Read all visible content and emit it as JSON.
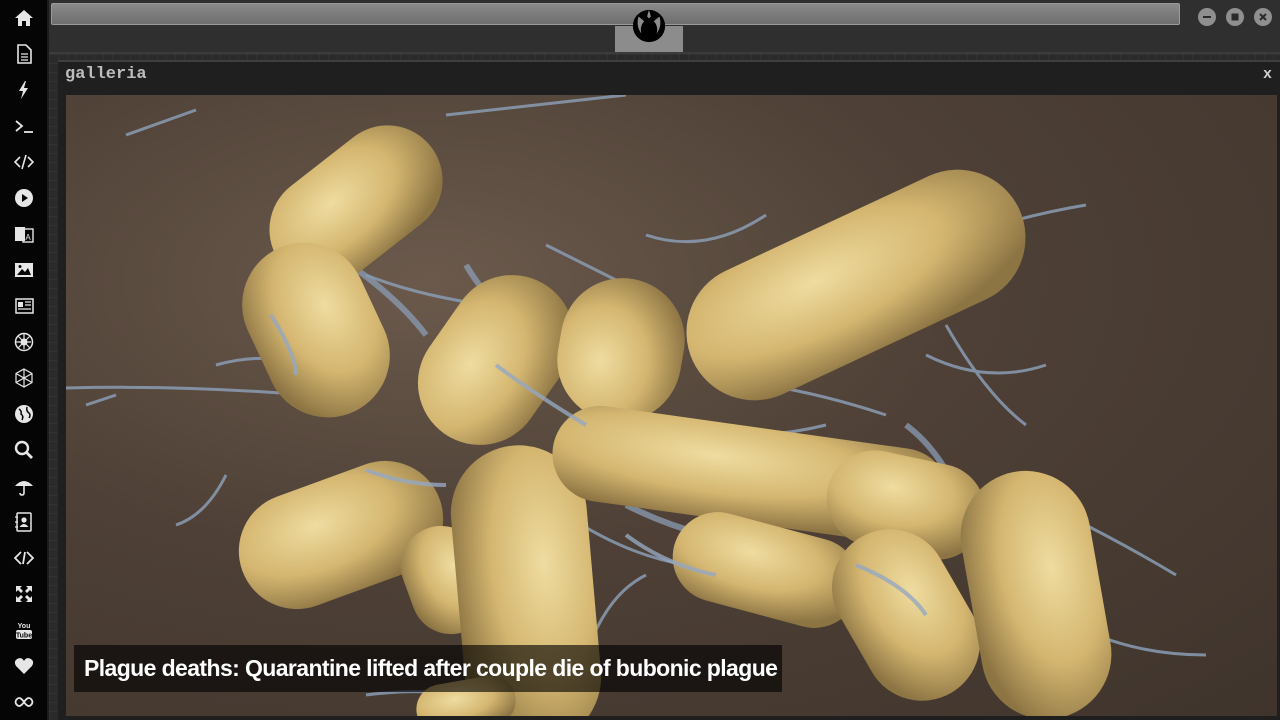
{
  "sidebar": {
    "items": [
      {
        "icon": "home-icon"
      },
      {
        "icon": "document-icon"
      },
      {
        "icon": "lightning-icon"
      },
      {
        "icon": "terminal-icon"
      },
      {
        "icon": "code-icon"
      },
      {
        "icon": "play-icon"
      },
      {
        "icon": "translate-icon"
      },
      {
        "icon": "image-icon"
      },
      {
        "icon": "newspaper-icon"
      },
      {
        "icon": "empire-icon"
      },
      {
        "icon": "hexagon-icon"
      },
      {
        "icon": "globe-icon"
      },
      {
        "icon": "search-icon"
      },
      {
        "icon": "umbrella-icon"
      },
      {
        "icon": "contacts-icon"
      },
      {
        "icon": "code-diamond-icon"
      },
      {
        "icon": "expand-icon"
      },
      {
        "icon": "youtube-icon"
      },
      {
        "icon": "heart-icon"
      },
      {
        "icon": "infinity-icon"
      }
    ]
  },
  "topbar": {
    "logo": "rebel-alliance-icon"
  },
  "gallery": {
    "title": "galleria",
    "close_label": "x",
    "caption": "Plague deaths: Quarantine lifted after couple die of bubonic plague"
  },
  "colors": {
    "bacteria": "#d8bf7a",
    "fibers": "#8a9cb4",
    "background": "#4e4036"
  }
}
